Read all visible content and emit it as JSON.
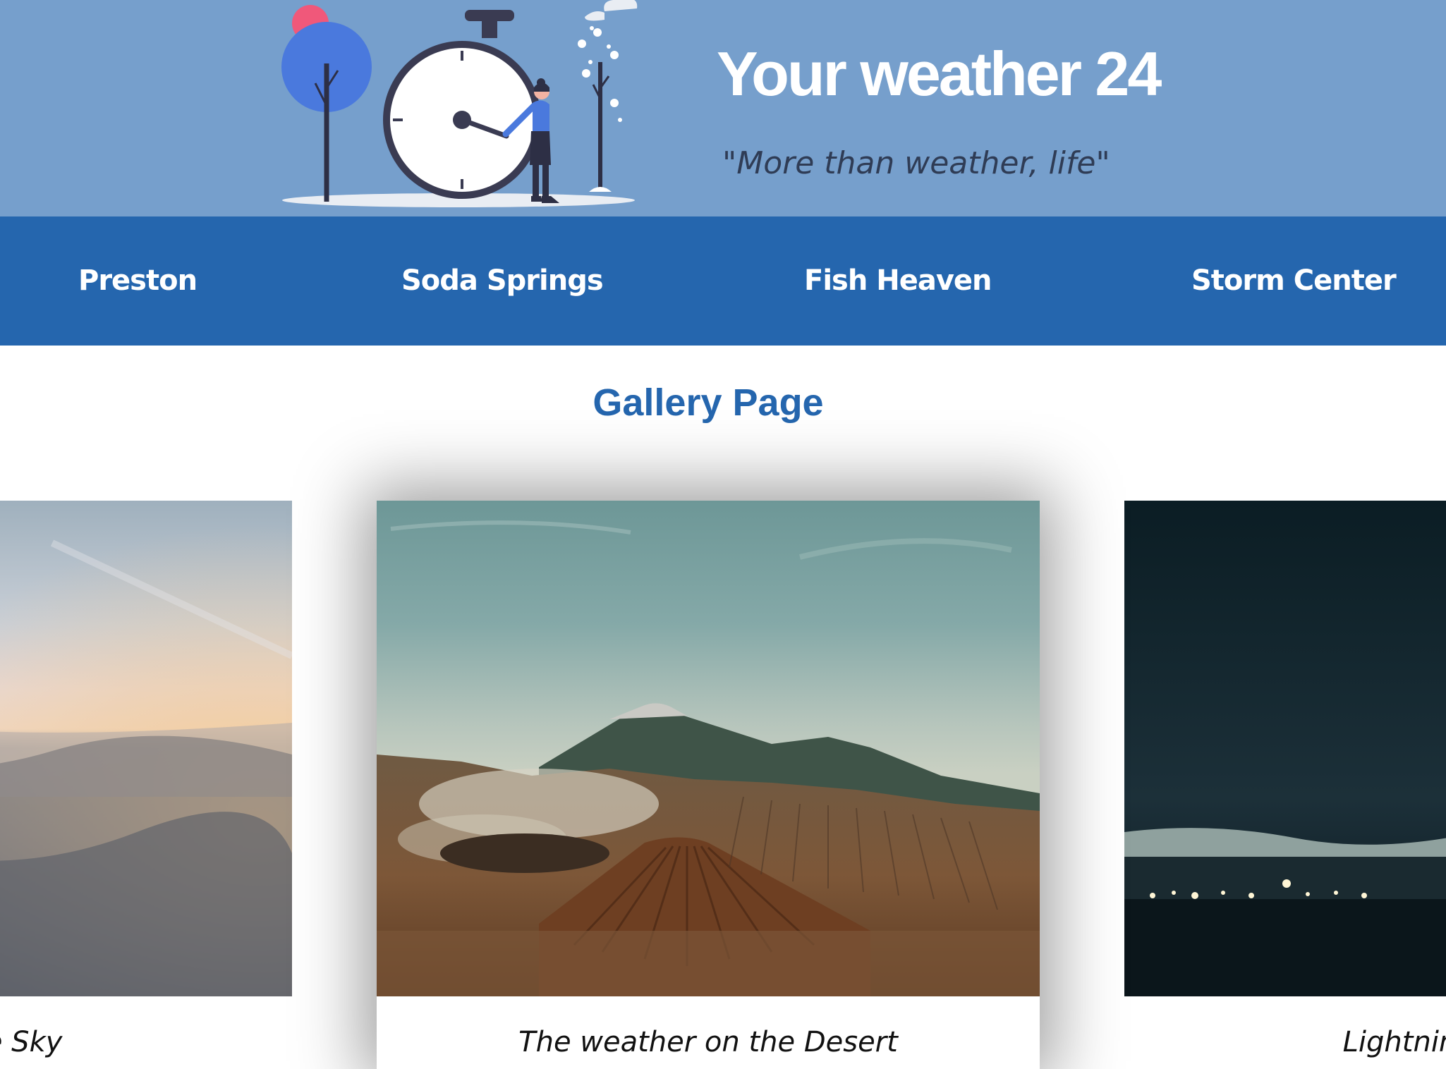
{
  "header": {
    "title": "Your weather 24",
    "tagline": "\"More than weather, life\""
  },
  "nav": {
    "items": [
      {
        "label": "Preston"
      },
      {
        "label": "Soda Springs"
      },
      {
        "label": "Fish Heaven"
      },
      {
        "label": "Storm Center"
      }
    ]
  },
  "gallery": {
    "title": "Gallery Page",
    "cards": [
      {
        "caption": "Above the Sky",
        "photo": "clouds-sunrise"
      },
      {
        "caption": "The weather on the Desert",
        "photo": "volcano-desert"
      },
      {
        "caption": "Lightning Storm",
        "photo": "night-city-lights"
      }
    ]
  },
  "colors": {
    "header_bg": "#769fcc",
    "nav_bg": "#2566ae",
    "accent": "#2566ae",
    "tagline": "#2f3c55"
  }
}
